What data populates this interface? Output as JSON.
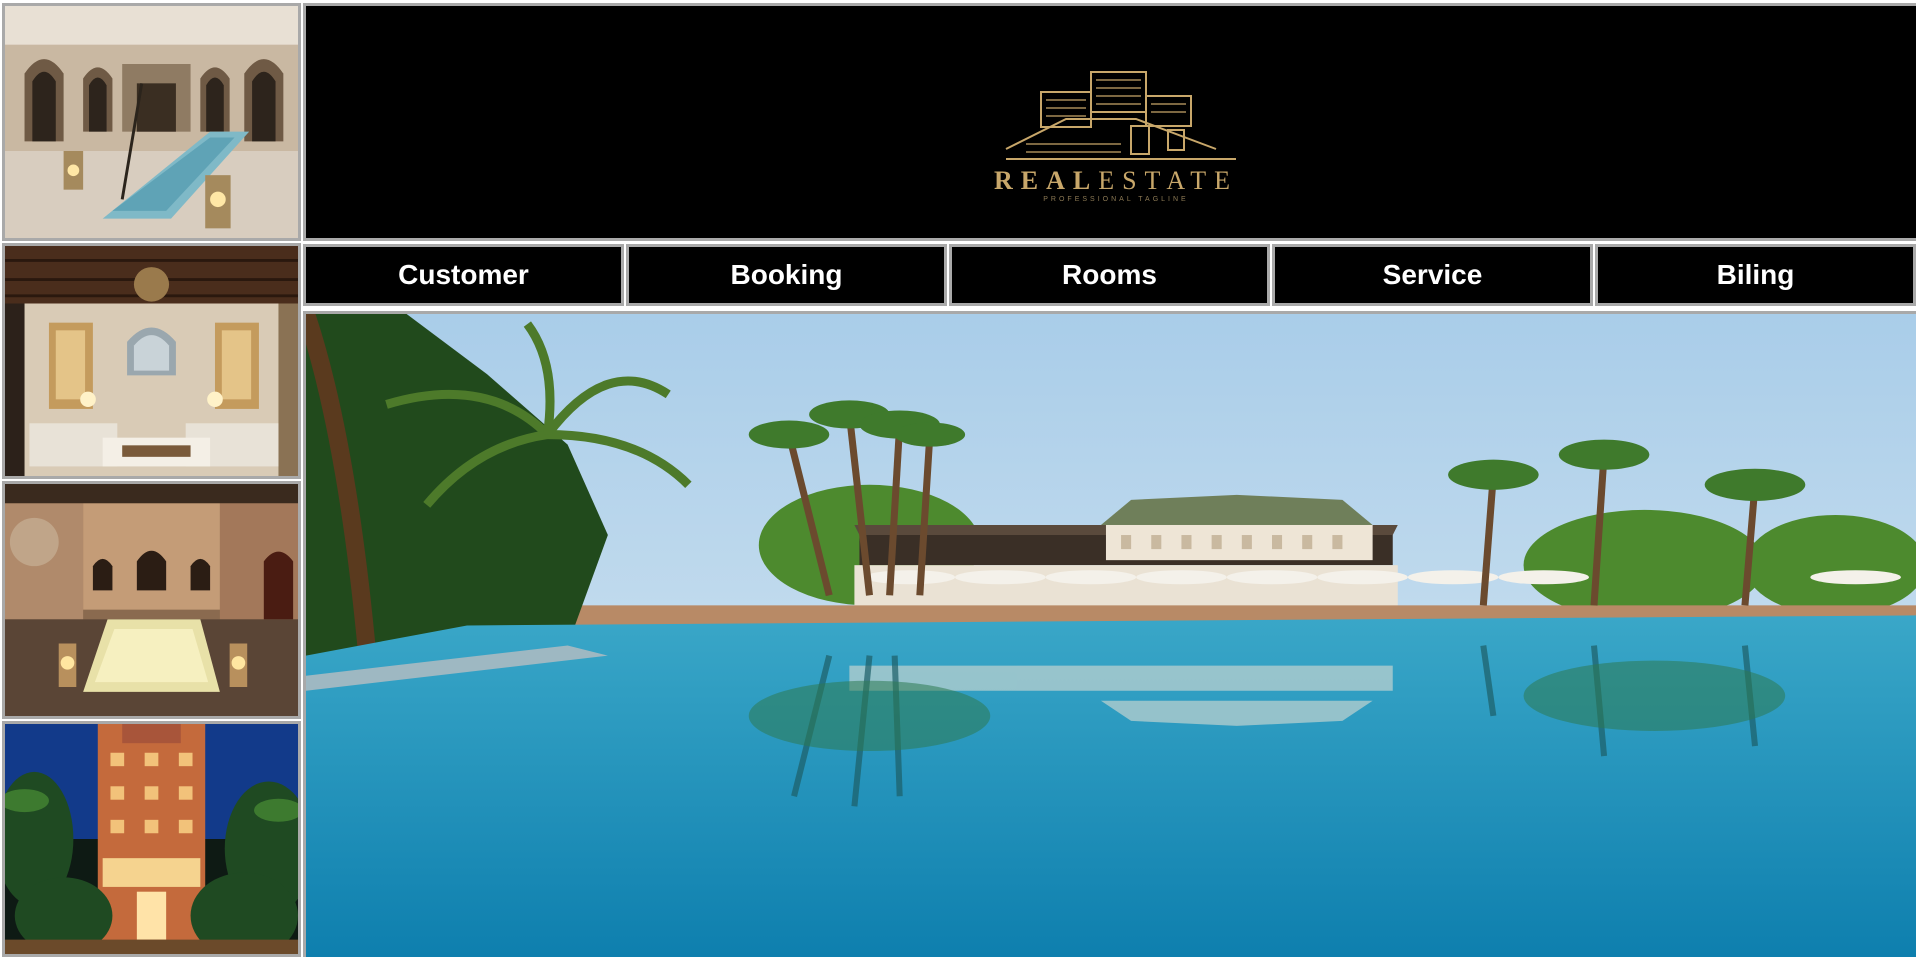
{
  "header": {
    "logo": {
      "icon": "house-logo-icon",
      "brand_part1": "REAL",
      "brand_part2": "ESTATE",
      "tagline": "PROFESSIONAL TAGLINE",
      "accent_color": "#c8a76a"
    }
  },
  "nav": {
    "items": [
      {
        "label": "Customer"
      },
      {
        "label": "Booking"
      },
      {
        "label": "Rooms"
      },
      {
        "label": "Service"
      },
      {
        "label": "Biling"
      }
    ]
  },
  "gallery": {
    "thumbnails": [
      {
        "icon": "riad-courtyard-pool-photo"
      },
      {
        "icon": "moroccan-lounge-photo"
      },
      {
        "icon": "candlelit-courtyard-pool-photo"
      },
      {
        "icon": "hotel-night-facade-photo"
      }
    ]
  },
  "hero": {
    "icon": "resort-pool-palms-photo"
  },
  "colors": {
    "header_bg": "#000000",
    "nav_bg": "#000000",
    "nav_text": "#ffffff",
    "frame_border": "#a9a9a9"
  }
}
